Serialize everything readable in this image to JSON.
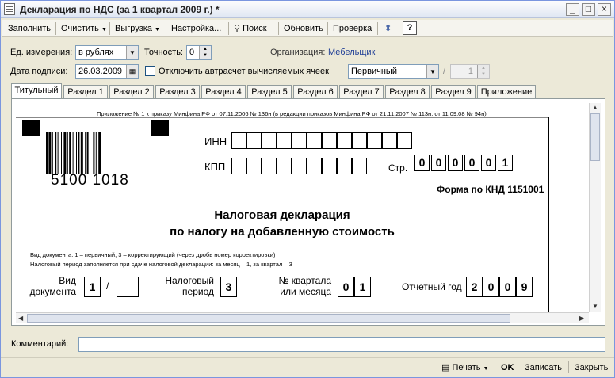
{
  "window": {
    "title": "Декларация по НДС (за 1 квартал 2009 г.) *"
  },
  "toolbar": {
    "fill": "Заполнить",
    "clear": "Очистить",
    "upload": "Выгрузка",
    "settings": "Настройка...",
    "search": "Поиск",
    "refresh": "Обновить",
    "check": "Проверка",
    "help": "?"
  },
  "form": {
    "unit_label": "Ед. измерения:",
    "unit_value": "в рублях",
    "precision_label": "Точность:",
    "precision_value": "0",
    "org_label": "Организация:",
    "org_value": "Мебельщик",
    "date_label": "Дата подписи:",
    "date_value": "26.03.2009",
    "autocalc_label": "Отключить автрасчет вычисляемых ячеек",
    "doc_kind_value": "Первичный",
    "slash": "/",
    "correction_value": "1"
  },
  "tabs": [
    "Титульный",
    "Раздел 1",
    "Раздел 2",
    "Раздел 3",
    "Раздел 4",
    "Раздел 5",
    "Раздел 6",
    "Раздел 7",
    "Раздел 8",
    "Раздел 9",
    "Приложение"
  ],
  "doc": {
    "header_note": "Приложение № 1 к приказу Минфина РФ от 07.11.2006 № 136н (в редакции приказов Минфина РФ от 21.11.2007 № 113н, от 11.09.08 № 94н)",
    "barcode_number": "5100 1018",
    "inn_label": "ИНН",
    "kpp_label": "КПП",
    "page_label": "Стр.",
    "page_digits": [
      "0",
      "0",
      "0",
      "0",
      "0",
      "1"
    ],
    "form_code": "Форма по КНД 1151001",
    "title_line1": "Налоговая декларация",
    "title_line2": "по налогу на добавленную стоимость",
    "note1": "Вид документа: 1 – первичный, 3 – корректирующий (через дробь номер корректировки)",
    "note2": "Налоговый период заполняется при сдаче налоговой декларации: за месяц – 1, за квартал – 3",
    "doc_kind_label1": "Вид",
    "doc_kind_label2": "документа",
    "doc_kind_value": "1",
    "doc_kind_slash": "/",
    "period_label1": "Налоговый",
    "period_label2": "период",
    "period_value": "3",
    "quarter_label1": "№ квартала",
    "quarter_label2": "или месяца",
    "quarter_digits": [
      "0",
      "1"
    ],
    "year_label": "Отчетный год",
    "year_digits": [
      "2",
      "0",
      "0",
      "9"
    ]
  },
  "comment": {
    "label": "Комментарий:",
    "value": ""
  },
  "footer": {
    "print": "Печать",
    "ok": "OK",
    "save": "Записать",
    "close": "Закрыть"
  }
}
